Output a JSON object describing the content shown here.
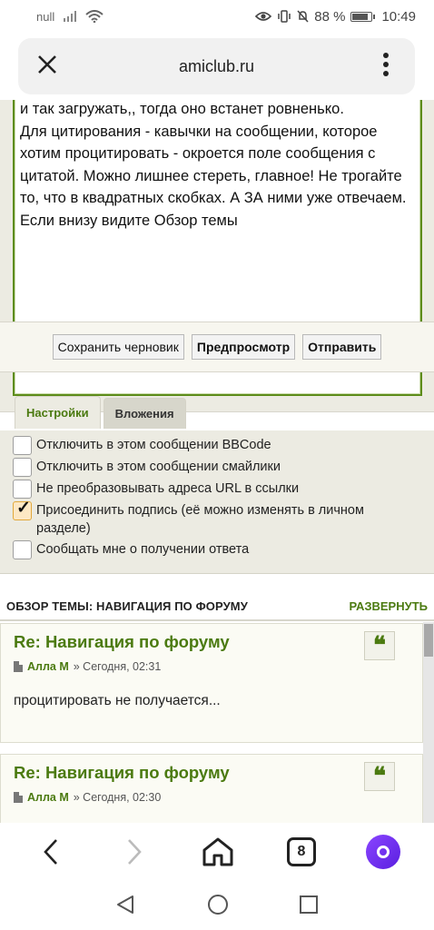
{
  "status_bar": {
    "carrier": "null",
    "battery": "88 %",
    "time": "10:49"
  },
  "browser": {
    "url": "amiclub.ru",
    "tabs_count": "8"
  },
  "editor": {
    "lines": [
      "и так загружать,, тогда оно встанет ровненько.",
      "Для цитирования - кавычки на сообщении, которое хотим процитировать - окроется поле сообщения с цитатой. Можно лишнее стереть, главное! Не трогайте то, что в квадратных скобках. А ЗА ними уже отвечаем.",
      "Если внизу видите Обзор темы"
    ]
  },
  "buttons": {
    "save_draft": "Сохранить черновик",
    "preview": "Предпросмотр",
    "submit": "Отправить"
  },
  "tabs": [
    {
      "label": "Настройки",
      "active": true
    },
    {
      "label": "Вложения",
      "active": false
    }
  ],
  "options": [
    {
      "label": "Отключить в этом сообщении BBCode",
      "checked": false
    },
    {
      "label": "Отключить в этом сообщении смайлики",
      "checked": false
    },
    {
      "label": "Не преобразовывать адреса URL в ссылки",
      "checked": false
    },
    {
      "label": "Присоединить подпись (её можно изменять в личном разделе)",
      "checked": true
    },
    {
      "label": "Сообщать мне о получении ответа",
      "checked": false
    }
  ],
  "topic_review": {
    "heading": "ОБЗОР ТЕМЫ: НАВИГАЦИЯ ПО ФОРУМУ",
    "expand": "РАЗВЕРНУТЬ"
  },
  "posts": [
    {
      "title": "Re: Навигация по форуму",
      "author": "Алла М",
      "date": "» Сегодня, 02:31",
      "body": "процитировать не получается..."
    },
    {
      "title": "Re: Навигация по форуму",
      "author": "Алла М",
      "date": "» Сегодня, 02:30",
      "body": ""
    }
  ],
  "colors": {
    "accent_green": "#4b7a10",
    "panel_bg": "#ecebe2",
    "checkbox_checked": "#fde8c4",
    "alice_purple": "#7a3bff"
  }
}
